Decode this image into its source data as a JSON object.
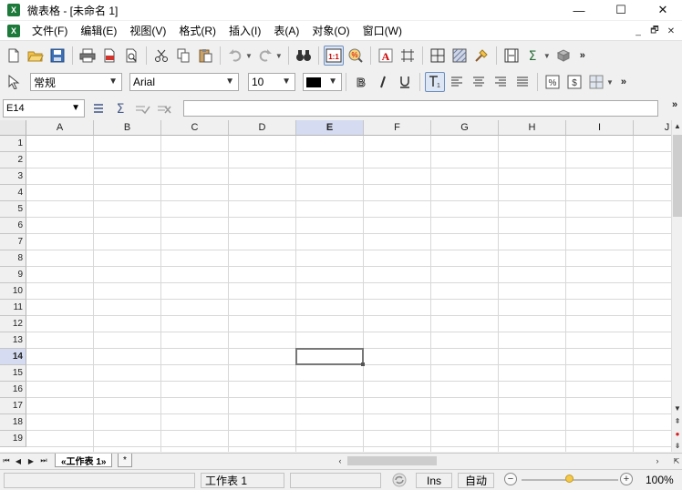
{
  "window": {
    "title": "微表格 - [未命名 1]",
    "minimize": "—",
    "maximize": "☐",
    "close": "✕"
  },
  "menu": {
    "items": [
      "文件(F)",
      "编辑(E)",
      "视图(V)",
      "格式(R)",
      "插入(I)",
      "表(A)",
      "对象(O)",
      "窗口(W)"
    ],
    "mdi_minimize": "_",
    "mdi_restore": "🗗",
    "mdi_close": "✕"
  },
  "format_toolbar": {
    "style": "常规",
    "font": "Arial",
    "size": "10",
    "text_color": "#000000"
  },
  "formula": {
    "cell_ref": "E14",
    "value": ""
  },
  "grid": {
    "columns": [
      "A",
      "B",
      "C",
      "D",
      "E",
      "F",
      "G",
      "H",
      "I",
      "J"
    ],
    "rows": [
      "1",
      "2",
      "3",
      "4",
      "5",
      "6",
      "7",
      "8",
      "9",
      "10",
      "11",
      "12",
      "13",
      "14",
      "15",
      "16",
      "17",
      "18",
      "19"
    ],
    "selected_column": "E",
    "selected_row": "14"
  },
  "sheets": {
    "tabs": [
      "«工作表 1»"
    ],
    "add": "*"
  },
  "status": {
    "sheet_name": "工作表 1",
    "insert_mode": "Ins",
    "calc_mode": "自动",
    "zoom": "100%",
    "zoom_level": 0.5
  },
  "colors": {
    "selection_header": "#d5dcf2",
    "grid_line": "#d8d8d8",
    "app_icon": "#1d7a3a"
  }
}
